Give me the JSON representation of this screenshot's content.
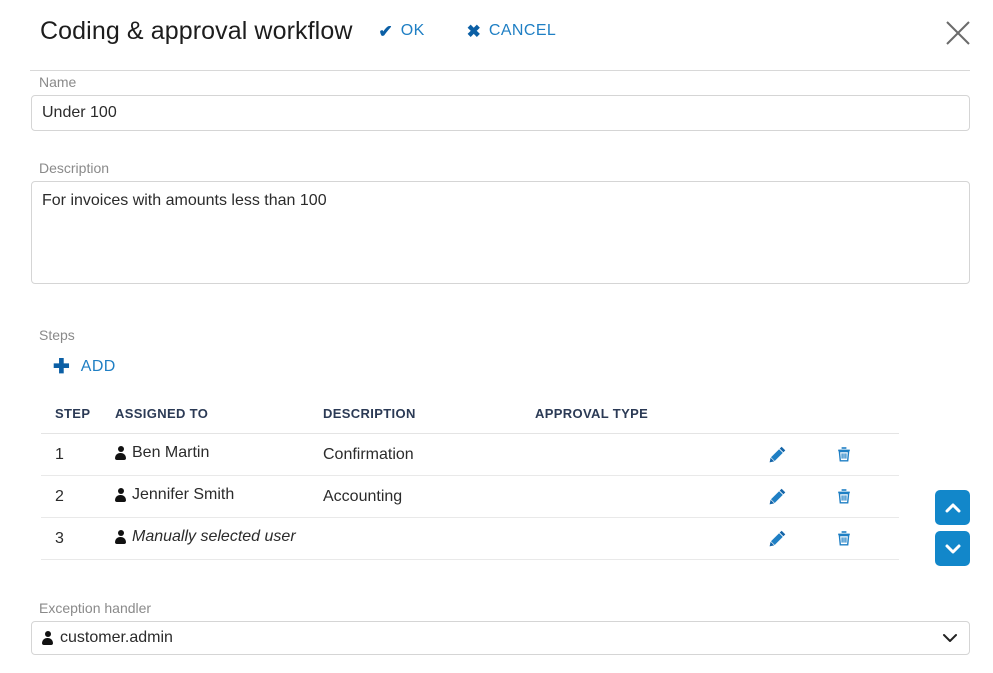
{
  "header": {
    "title": "Coding & approval workflow",
    "ok_label": "OK",
    "ok_icon": "check-icon",
    "cancel_label": "CANCEL",
    "cancel_icon": "x-icon",
    "close_icon": "close-icon",
    "link_color": "#1f7fc4",
    "glyph_color": "#0b5fa5"
  },
  "name_field": {
    "label": "Name",
    "value": "Under 100",
    "placeholder": ""
  },
  "description_field": {
    "label": "Description",
    "value": "For invoices with amounts less than 100",
    "placeholder": ""
  },
  "steps": {
    "label": "Steps",
    "add_label": "ADD",
    "add_icon": "plus-icon",
    "columns": [
      "STEP",
      "ASSIGNED TO",
      "DESCRIPTION",
      "APPROVAL TYPE"
    ],
    "rows": [
      {
        "step": "1",
        "assigned_to": "Ben Martin",
        "assigned_icon": "user-icon",
        "manual": false,
        "description": "Confirmation",
        "approval_type": "",
        "edit_icon": "pencil-icon",
        "delete_icon": "trash-icon"
      },
      {
        "step": "2",
        "assigned_to": "Jennifer Smith",
        "assigned_icon": "user-icon",
        "manual": false,
        "description": "Accounting",
        "approval_type": "",
        "edit_icon": "pencil-icon",
        "delete_icon": "trash-icon"
      },
      {
        "step": "3",
        "assigned_to": "Manually selected user",
        "assigned_icon": "user-icon",
        "manual": true,
        "description": "",
        "approval_type": "",
        "edit_icon": "pencil-icon",
        "delete_icon": "trash-icon"
      }
    ]
  },
  "reorder": {
    "move_up_icon": "chevron-up-icon",
    "move_down_icon": "chevron-down-icon",
    "button_color": "#1287ca"
  },
  "exception_handler": {
    "label": "Exception handler",
    "value": "customer.admin",
    "user_icon": "user-icon",
    "chevron_icon": "chevron-down-icon"
  }
}
